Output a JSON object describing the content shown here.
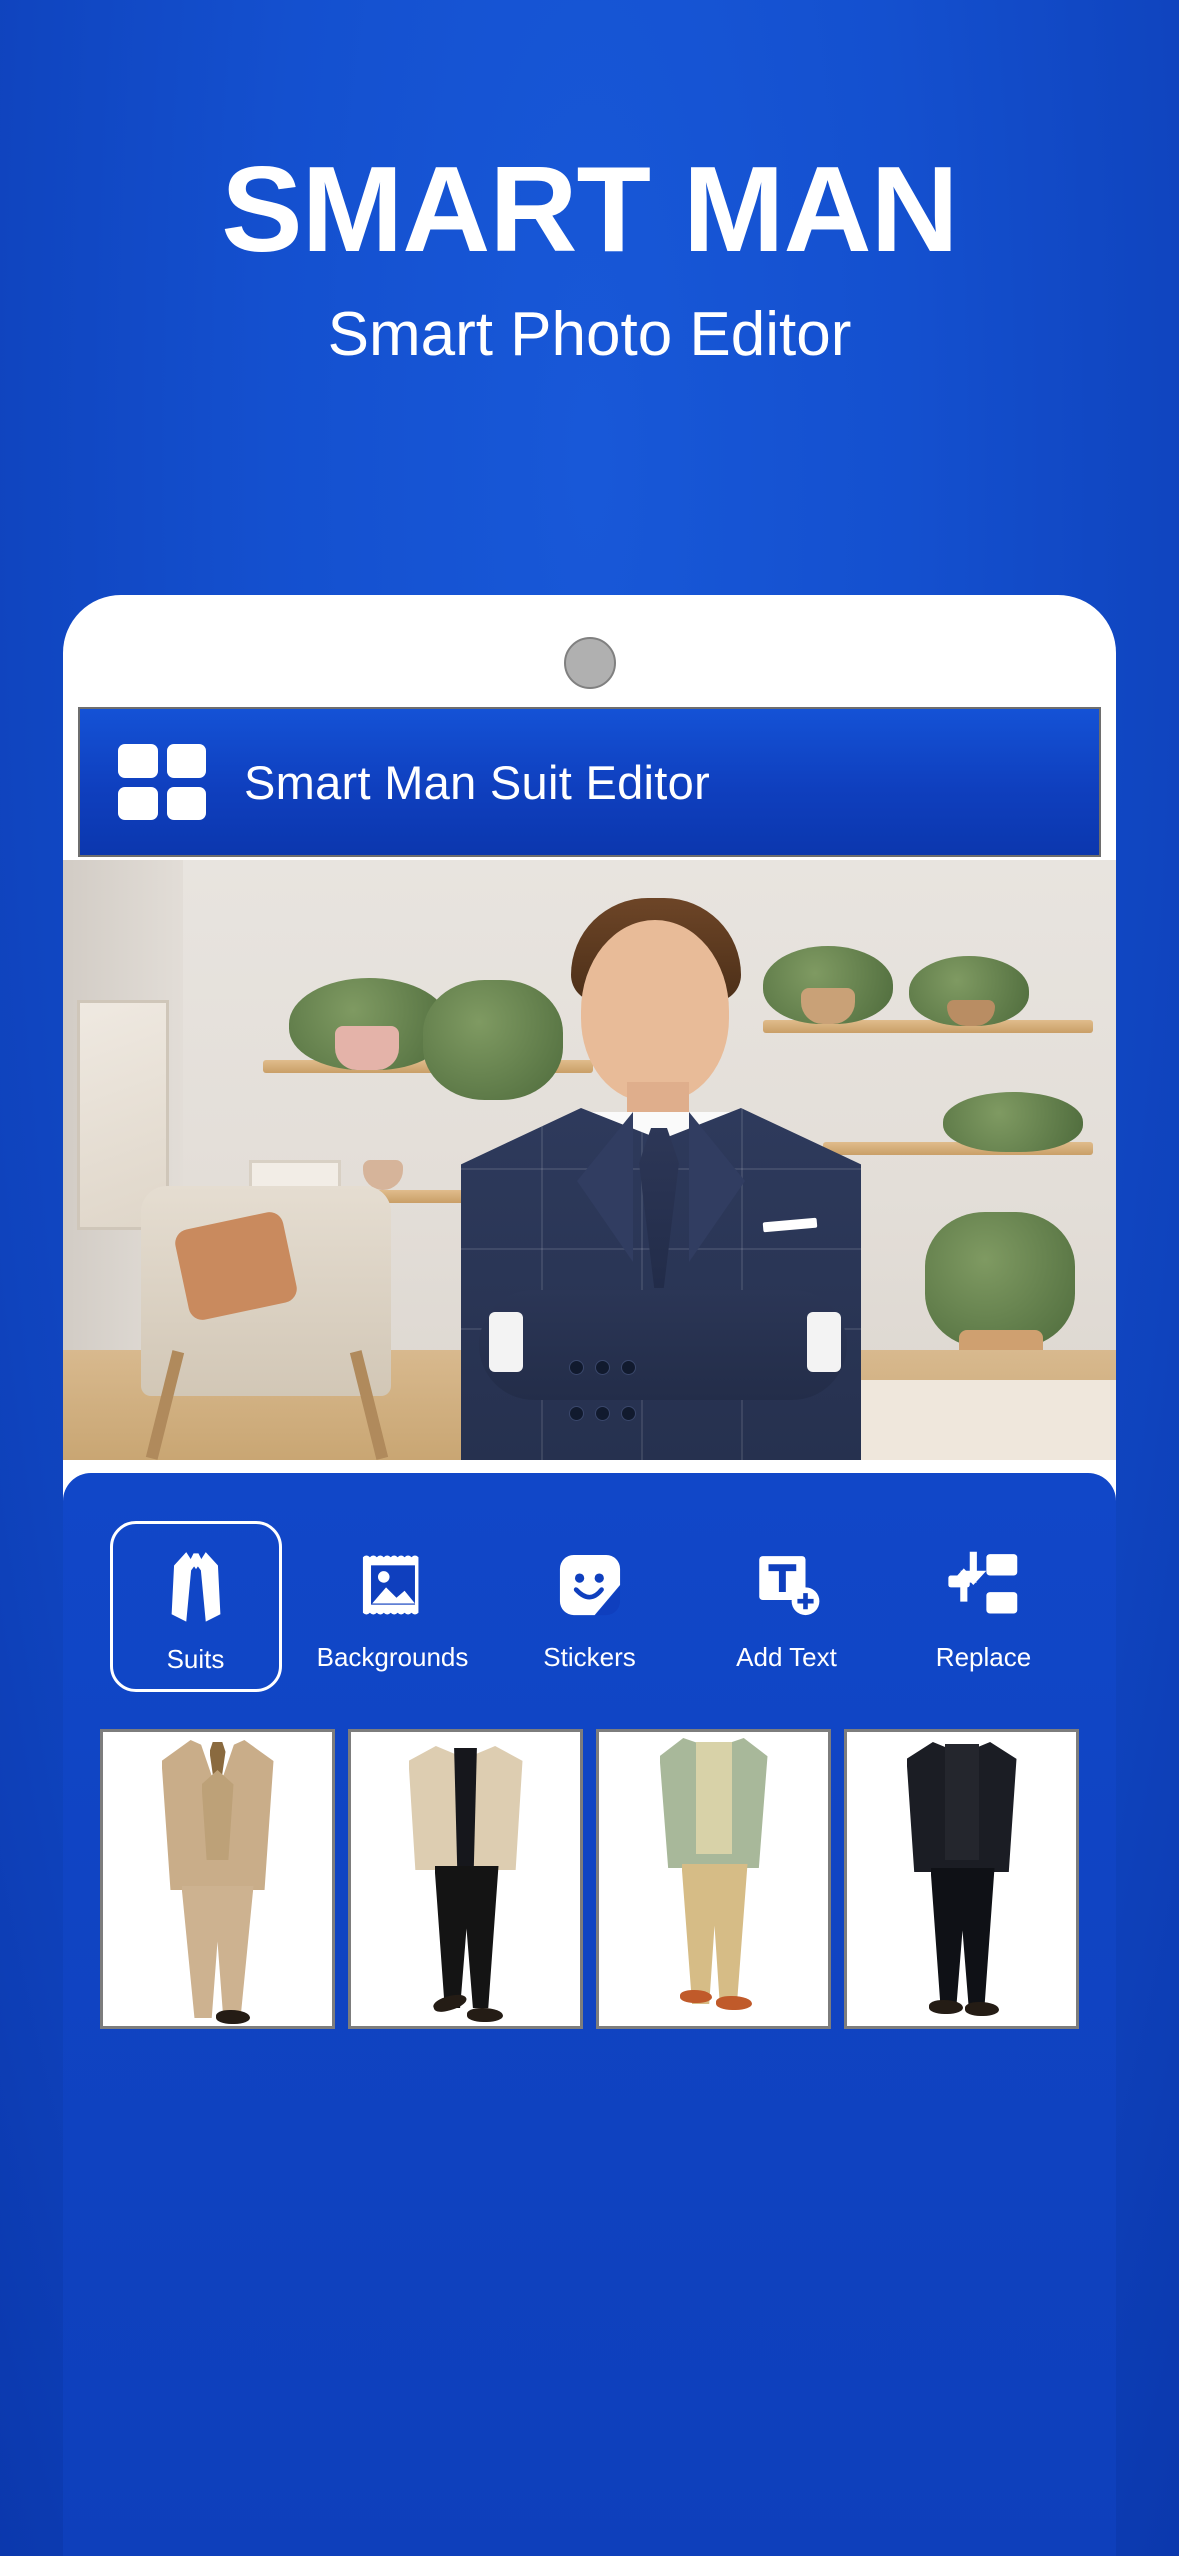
{
  "promo": {
    "title": "SMART MAN",
    "subtitle": "Smart Photo Editor"
  },
  "colors": {
    "brand_blue": "#1450cf",
    "appbar_blue": "#0f3fbe",
    "panel_blue": "#1147c8",
    "white": "#ffffff",
    "camera_gray": "#b0b0b0",
    "thumb_border": "#7d7d7d"
  },
  "app": {
    "appbar": {
      "menu_icon": "grid-four-squares-icon",
      "title": "Smart Man Suit Editor"
    },
    "canvas": {
      "description": "Young man in navy checked suit with tie, arms crossed, standing in a bright living room with wooden shelves, potted plants, armchair and wooden floor"
    },
    "toolbar": {
      "selected": "Suits",
      "items": [
        {
          "label": "Suits",
          "icon": "suit-jacket-icon",
          "selected": true
        },
        {
          "label": "Backgrounds",
          "icon": "photo-frame-icon",
          "selected": false
        },
        {
          "label": "Stickers",
          "icon": "smiley-sticker-icon",
          "selected": false
        },
        {
          "label": "Add Text",
          "icon": "text-box-plus-icon",
          "selected": false
        },
        {
          "label": "Replace",
          "icon": "swap-arrows-icon",
          "selected": false
        }
      ]
    },
    "suit_thumbnails": [
      {
        "name": "Tan three-piece suit",
        "jacket_color": "#c9ad89",
        "pants_color": "#cdb290",
        "shirt_color": "#ffffff",
        "tie_color": "#8a6a3f"
      },
      {
        "name": "Cream blazer with black outfit",
        "jacket_color": "#ddcdb1",
        "pants_color": "#141414",
        "shirt_color": "#16171c",
        "tie_color": "#16171c"
      },
      {
        "name": "Sage green jacket with khakis",
        "jacket_color": "#a8b89a",
        "pants_color": "#d6bc86",
        "shirt_color": "#d8d2a8",
        "tie_color": "#9aa98d"
      },
      {
        "name": "Black slim suit",
        "jacket_color": "#1b1d24",
        "pants_color": "#0f1116",
        "shirt_color": "#24262d",
        "tie_color": "#0f1116"
      }
    ]
  }
}
